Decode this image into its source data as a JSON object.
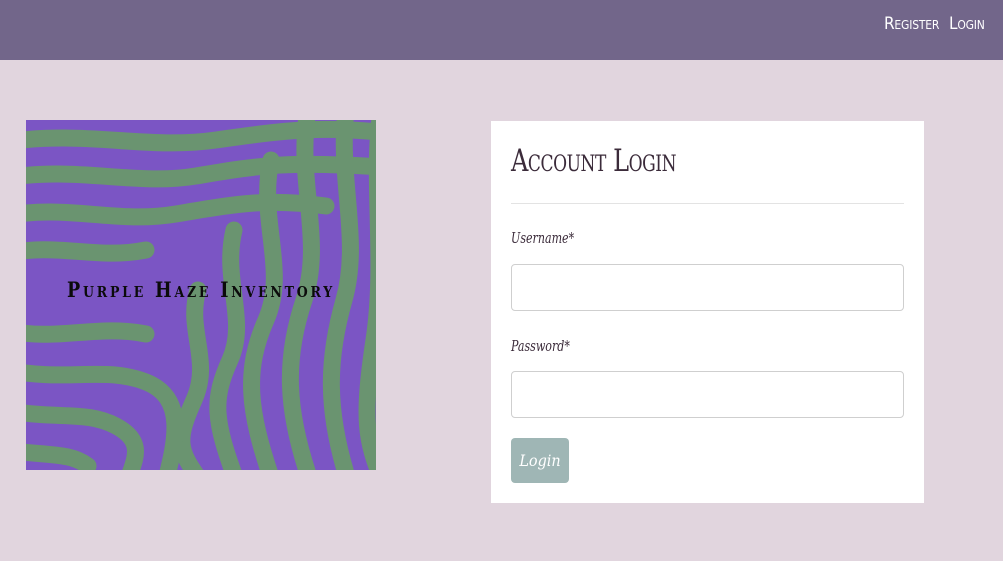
{
  "nav": {
    "register_label": "Register",
    "login_label": "Login"
  },
  "logo": {
    "text": "Purple Haze Inventory"
  },
  "login_form": {
    "title": "Account Login",
    "username_label": "Username*",
    "username_value": "",
    "password_label": "Password*",
    "password_value": "",
    "submit_label": "Login"
  },
  "colors": {
    "navbar": "#72668a",
    "page_background": "#e1d5de",
    "logo_purple": "#7b55c4",
    "logo_green": "#6a9470",
    "button": "#9fb6b5"
  }
}
